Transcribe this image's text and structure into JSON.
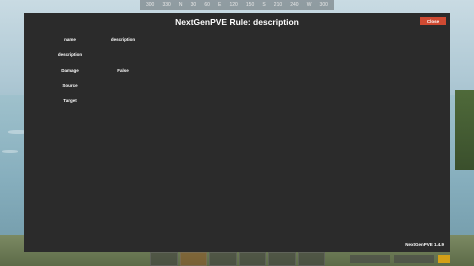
{
  "window": {
    "title": "NextGenPVE Rule: description",
    "close_label": "Close",
    "version": "NextGenPVE 1.4.9"
  },
  "fields": [
    {
      "label": "name",
      "value": "description"
    },
    {
      "label": "description",
      "value": ""
    },
    {
      "label": "Damage",
      "value": "False"
    },
    {
      "label": "Source",
      "value": ""
    },
    {
      "label": "Target",
      "value": ""
    }
  ],
  "compass": [
    "300",
    "330",
    "N",
    "30",
    "60",
    "E",
    "120",
    "150",
    "S",
    "210",
    "240",
    "W",
    "300"
  ],
  "colors": {
    "panel_bg": "#2b2b2b",
    "close_bg": "#cf4a32",
    "text": "#ffffff"
  }
}
